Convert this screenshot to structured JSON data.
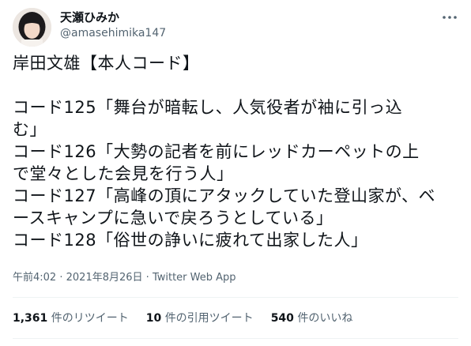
{
  "author": {
    "display_name": "天瀬ひみか",
    "handle": "@amasehimika147"
  },
  "tweet": {
    "title_line": "岸田文雄【本人コード】",
    "lines": [
      "コード125「舞台が暗転し、人気役者が袖に引っ込",
      "む」",
      "コード126「大勢の記者を前にレッドカーペットの上",
      "で堂々とした会見を行う人」",
      "コード127「高峰の頂にアタックしていた登山家が、ベ",
      "ースキャンプに急いで戻ろうとしている」",
      "コード128「俗世の諍いに疲れて出家した人」"
    ]
  },
  "meta": {
    "time": "午前4:02",
    "separator": "·",
    "date": "2021年8月26日",
    "source": "Twitter Web App"
  },
  "stats": {
    "retweets_count": "1,361",
    "retweets_label": "件のリツイート",
    "quotes_count": "10",
    "quotes_label": "件の引用ツイート",
    "likes_count": "540",
    "likes_label": "件のいいね"
  },
  "icons": {
    "more": "more-horizontal-icon"
  },
  "colors": {
    "text": "#0f1419",
    "secondary": "#536471",
    "divider": "#eff3f4"
  }
}
